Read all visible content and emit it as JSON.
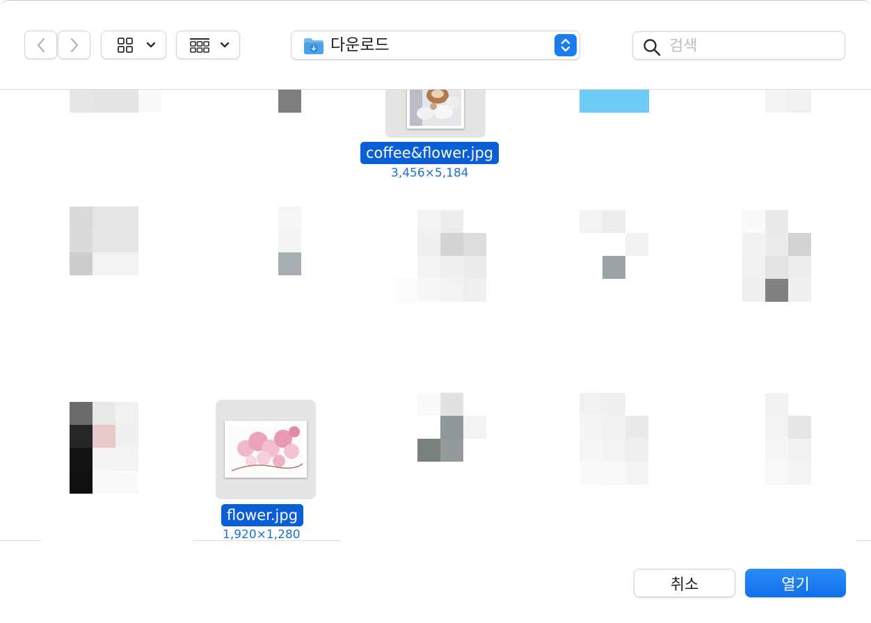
{
  "toolbar": {
    "location": {
      "label": "다운로드",
      "icon": "downloads-folder-icon",
      "accent": "#1a7cf0"
    },
    "search": {
      "placeholder": "검색",
      "value": ""
    }
  },
  "files": {
    "selected_items": [
      {
        "name": "coffee&flower.jpg",
        "dimensions": "3,456×5,184"
      },
      {
        "name": "flower.jpg",
        "dimensions": "1,920×1,280"
      }
    ]
  },
  "footer": {
    "cancel_label": "취소",
    "open_label": "열기"
  },
  "colors": {
    "selection": "#0a5fd6",
    "dimension_text": "#1a6fd8",
    "primary_button": "#1a7cf0",
    "thumbnail_background": "#e4e4e4"
  }
}
